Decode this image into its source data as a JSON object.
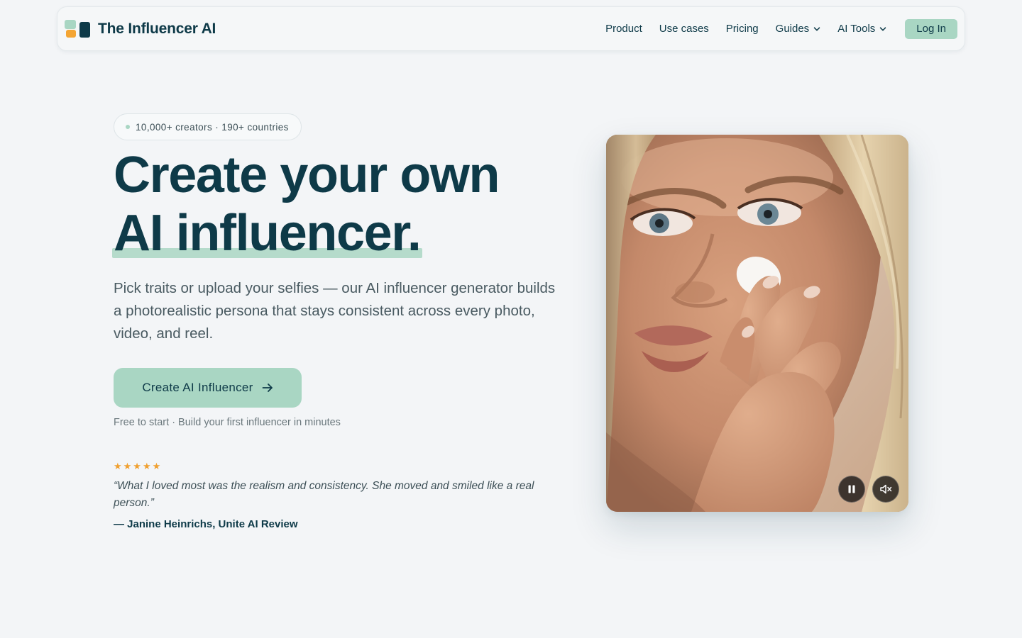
{
  "brand": {
    "name": "The Influencer AI",
    "colors": {
      "primary": "#0e3a48",
      "accent": "#a9d6c3",
      "orange": "#f4a533",
      "background": "#f3f5f7"
    }
  },
  "nav": {
    "links": [
      {
        "label": "Product",
        "dropdown": false
      },
      {
        "label": "Use cases",
        "dropdown": false
      },
      {
        "label": "Pricing",
        "dropdown": false
      },
      {
        "label": "Guides",
        "dropdown": true,
        "icon": "chevron-down-icon"
      },
      {
        "label": "AI Tools",
        "dropdown": true,
        "icon": "chevron-down-icon"
      }
    ],
    "login_label": "Log In"
  },
  "hero": {
    "badge": "10,000+ creators · 190+ countries",
    "headline_line1": "Create your own",
    "headline_line2": "AI influencer.",
    "subtext": "Pick traits or upload your selfies — our AI influencer generator builds a photorealistic persona that stays consistent across every photo, video, and reel.",
    "cta_label": "Create AI Influencer",
    "cta_icon": "arrow-right-icon",
    "cta_note": "Free to start · Build your first influencer in minutes"
  },
  "testimonial": {
    "stars": "★★★★★",
    "rating": 5,
    "quote": "“What I loved most was the realism and consistency. She moved and smiled like a real person.”",
    "attribution": "— Janine Heinrichs, Unite AI Review"
  },
  "media": {
    "controls": [
      {
        "name": "pause-button",
        "icon": "pause-icon"
      },
      {
        "name": "mute-button",
        "icon": "volume-muted-icon"
      }
    ]
  }
}
